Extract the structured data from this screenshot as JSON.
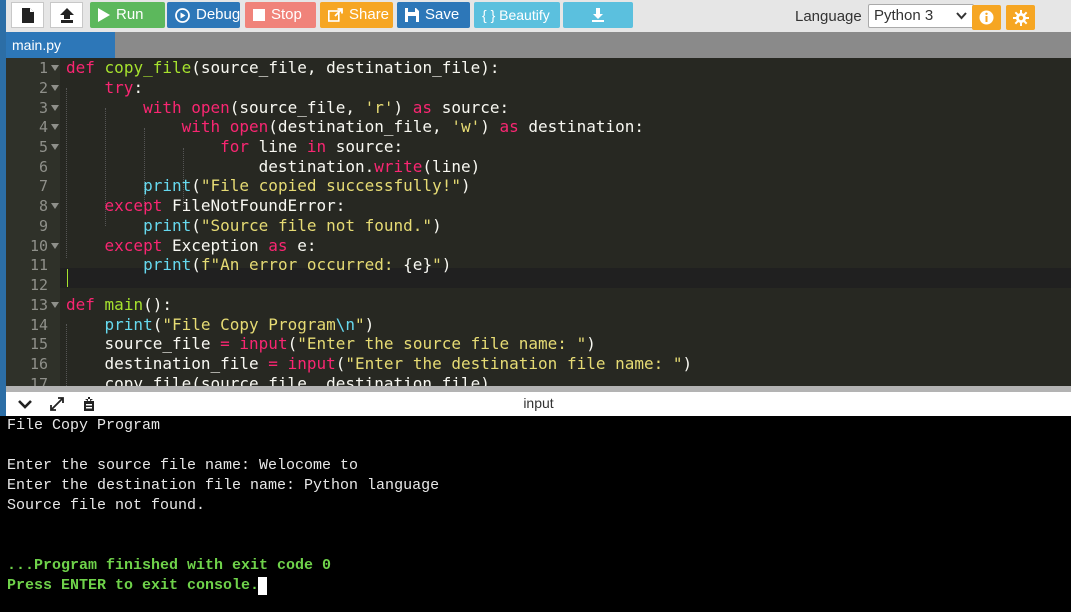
{
  "toolbar": {
    "run_label": "Run",
    "debug_label": "Debug",
    "stop_label": "Stop",
    "share_label": "Share",
    "save_label": "Save",
    "beautify_label": "{ } Beautify",
    "language_label": "Language",
    "language_value": "Python 3",
    "colors": {
      "run": "#5cb85c",
      "debug": "#2d77b8",
      "stop": "#f0837a",
      "share": "#f6a623",
      "save": "#2d77b8",
      "beautify": "#5bc0de",
      "download": "#5bc0de",
      "info": "#f6a623",
      "settings": "#f6a623"
    }
  },
  "editor": {
    "tab": "main.py",
    "line_numbers": [
      "1",
      "2",
      "3",
      "4",
      "5",
      "6",
      "7",
      "8",
      "9",
      "10",
      "11",
      "12",
      "13",
      "14",
      "15",
      "16",
      "17"
    ],
    "fold_lines": [
      "1",
      "2",
      "3",
      "4",
      "5",
      "8",
      "10",
      "13"
    ]
  },
  "io": {
    "title": "input",
    "console_lines": [
      "File Copy Program",
      "",
      "Enter the source file name: Welocome to",
      "Enter the destination file name: Python language",
      "Source file not found.",
      "",
      "",
      "...Program finished with exit code 0",
      "Press ENTER to exit console."
    ]
  }
}
